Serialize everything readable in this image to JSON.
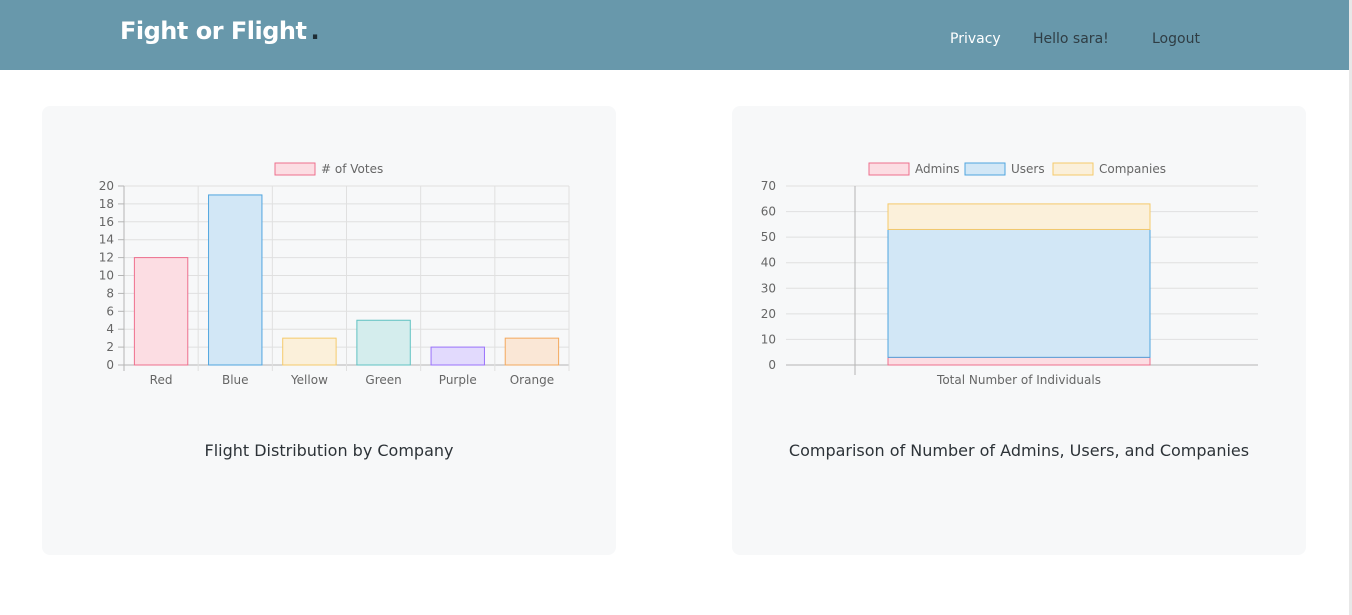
{
  "header": {
    "brand": "Fight or Flight",
    "brand_dot": ".",
    "nav": {
      "privacy": "Privacy",
      "hello": "Hello sara!",
      "logout": "Logout"
    }
  },
  "cards": [
    {
      "title": "Flight Distribution by Company"
    },
    {
      "title": "Comparison of Number of Admins, Users, and Companies"
    }
  ],
  "chart_data": [
    {
      "type": "bar",
      "categories": [
        "Red",
        "Blue",
        "Yellow",
        "Green",
        "Purple",
        "Orange"
      ],
      "series": [
        {
          "name": "# of Votes",
          "values": [
            12,
            19,
            3,
            5,
            2,
            3
          ]
        }
      ],
      "ylim": [
        0,
        20
      ],
      "yticks": [
        0,
        2,
        4,
        6,
        8,
        10,
        12,
        14,
        16,
        18,
        20
      ],
      "grid": true,
      "legend": "top",
      "colors": {
        "fill": [
          "#fcdde3",
          "#d2e7f6",
          "#fbf0da",
          "#d4eded",
          "#e2dafd",
          "#fae7d6"
        ],
        "stroke": [
          "#ee6f8d",
          "#4fa5df",
          "#f5ca6b",
          "#5fc2c2",
          "#9a72fb",
          "#f3a85d"
        ]
      }
    },
    {
      "type": "bar",
      "stacked": true,
      "categories": [
        "Total Number of Individuals"
      ],
      "series": [
        {
          "name": "Admins",
          "values": [
            3
          ]
        },
        {
          "name": "Users",
          "values": [
            50
          ]
        },
        {
          "name": "Companies",
          "values": [
            10
          ]
        }
      ],
      "ylim": [
        0,
        70
      ],
      "yticks": [
        0,
        10,
        20,
        30,
        40,
        50,
        60,
        70
      ],
      "grid": true,
      "legend": "top",
      "colors": {
        "fill": [
          "#fcdde3",
          "#d2e7f6",
          "#fbf0da"
        ],
        "stroke": [
          "#ee6f8d",
          "#4fa5df",
          "#f5ca6b"
        ]
      }
    }
  ]
}
